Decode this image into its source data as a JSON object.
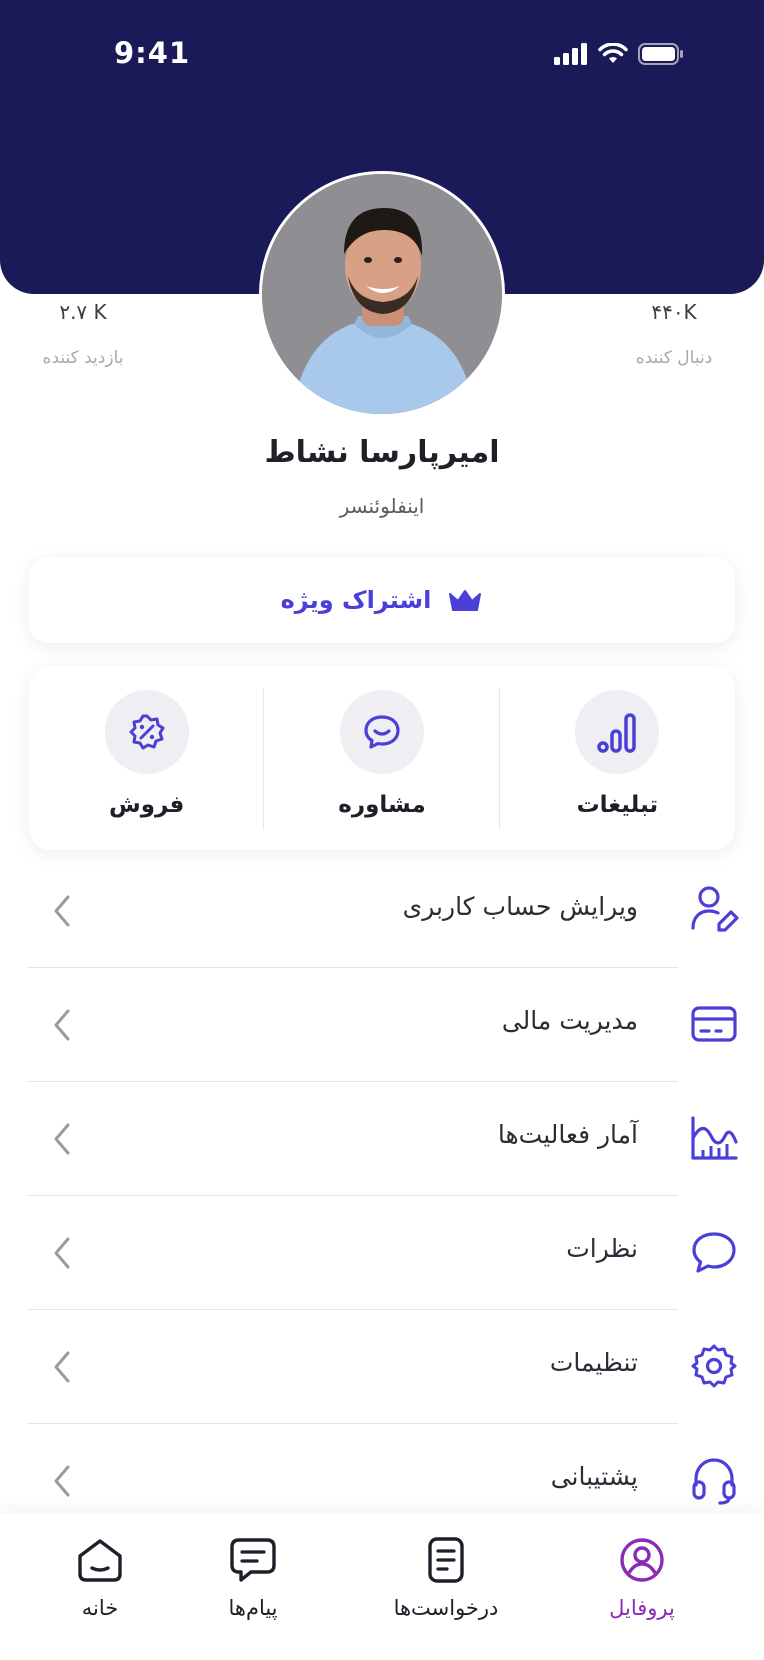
{
  "status_bar": {
    "time": "9:41"
  },
  "colors": {
    "header_bg": "#1b1a59",
    "accent": "#4a3fd6",
    "active_tab": "#8a2bb8"
  },
  "profile": {
    "name": "امیرپارسا نشاط",
    "role": "اینفلوئنسر",
    "followers_value": "۴۴۰K",
    "followers_label": "دنبال کننده",
    "visitors_value": "۲.۷ K",
    "visitors_label": "بازدید کننده"
  },
  "premium": {
    "label": "اشتراک ویژه",
    "icon": "crown-icon"
  },
  "services": [
    {
      "label": "تبلیغات",
      "icon": "bar-chart-icon"
    },
    {
      "label": "مشاوره",
      "icon": "chat-bubble-icon"
    },
    {
      "label": "فروش",
      "icon": "discount-badge-icon"
    }
  ],
  "menu": [
    {
      "label": "ویرایش حساب کاربری",
      "icon": "user-edit-icon"
    },
    {
      "label": "مدیریت مالی",
      "icon": "credit-card-icon"
    },
    {
      "label": "آمار فعالیت‌ها",
      "icon": "activity-chart-icon"
    },
    {
      "label": "نظرات",
      "icon": "comment-icon"
    },
    {
      "label": "تنظیمات",
      "icon": "gear-icon"
    },
    {
      "label": "پشتیبانی",
      "icon": "headset-icon"
    }
  ],
  "tabbar": [
    {
      "label": "پروفایل",
      "icon": "profile-icon",
      "active": true
    },
    {
      "label": "درخواست‌ها",
      "icon": "document-icon",
      "active": false
    },
    {
      "label": "پیام‌ها",
      "icon": "message-icon",
      "active": false
    },
    {
      "label": "خانه",
      "icon": "home-icon",
      "active": false
    }
  ]
}
